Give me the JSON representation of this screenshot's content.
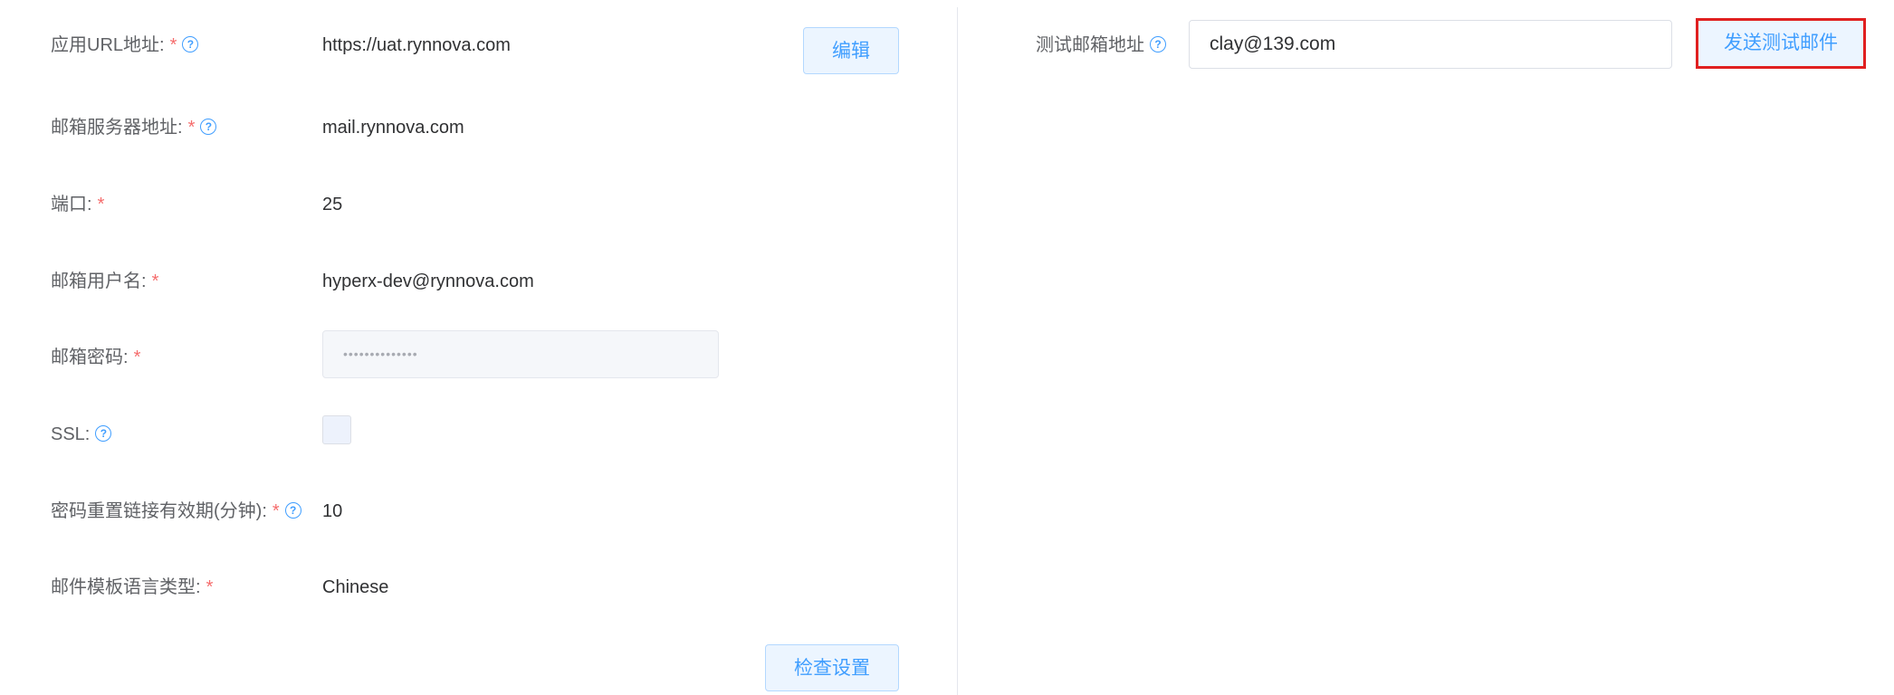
{
  "left": {
    "fields": [
      {
        "label": "应用URL地址:",
        "required": "*",
        "help": "?",
        "value": "https://uat.rynnova.com"
      },
      {
        "label": "邮箱服务器地址:",
        "required": "*",
        "help": "?",
        "value": "mail.rynnova.com"
      },
      {
        "label": "端口:",
        "required": "*",
        "value": "25"
      },
      {
        "label": "邮箱用户名:",
        "required": "*",
        "value": "hyperx-dev@rynnova.com"
      },
      {
        "label": "邮箱密码:",
        "required": "*",
        "value": "••••••••••••••"
      },
      {
        "label": "SSL:",
        "help": "?",
        "checked": false
      },
      {
        "label": "密码重置链接有效期(分钟):",
        "required": "*",
        "help": "?",
        "value": "10"
      },
      {
        "label": "邮件模板语言类型:",
        "required": "*",
        "value": "Chinese"
      }
    ],
    "edit_button": "编辑",
    "check_button": "检查设置"
  },
  "right": {
    "test_email_label": "测试邮箱地址",
    "help": "?",
    "test_email_value": "clay@139.com",
    "send_button": "发送测试邮件"
  },
  "colors": {
    "primary": "#409eff",
    "required": "#f56c6c",
    "highlight_border": "#e02020"
  }
}
